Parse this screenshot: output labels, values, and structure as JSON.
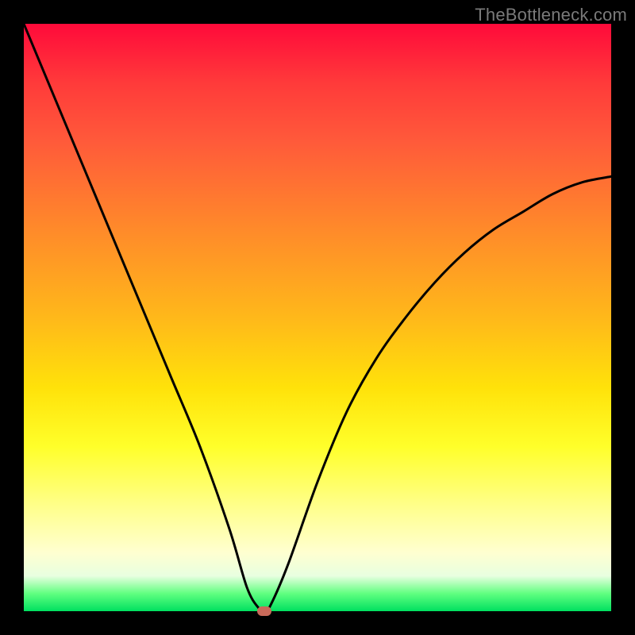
{
  "watermark": "TheBottleneck.com",
  "chart_data": {
    "type": "line",
    "title": "",
    "xlabel": "",
    "ylabel": "",
    "xlim": [
      0,
      100
    ],
    "ylim": [
      0,
      100
    ],
    "grid": false,
    "legend": false,
    "background_gradient": {
      "top": "#ff0a3a",
      "middle": "#ffe20a",
      "bottom": "#00e060"
    },
    "series": [
      {
        "name": "bottleneck-curve",
        "color": "#000000",
        "x": [
          0,
          5,
          10,
          15,
          20,
          25,
          30,
          35,
          38,
          40,
          41,
          42,
          45,
          50,
          55,
          60,
          65,
          70,
          75,
          80,
          85,
          90,
          95,
          100
        ],
        "y": [
          100,
          88,
          76,
          64,
          52,
          40,
          28,
          14,
          4,
          0.5,
          0,
          1,
          8,
          22,
          34,
          43,
          50,
          56,
          61,
          65,
          68,
          71,
          73,
          74
        ]
      }
    ],
    "minimum_marker": {
      "x": 41,
      "y": 0,
      "color": "#c96a5a"
    }
  }
}
